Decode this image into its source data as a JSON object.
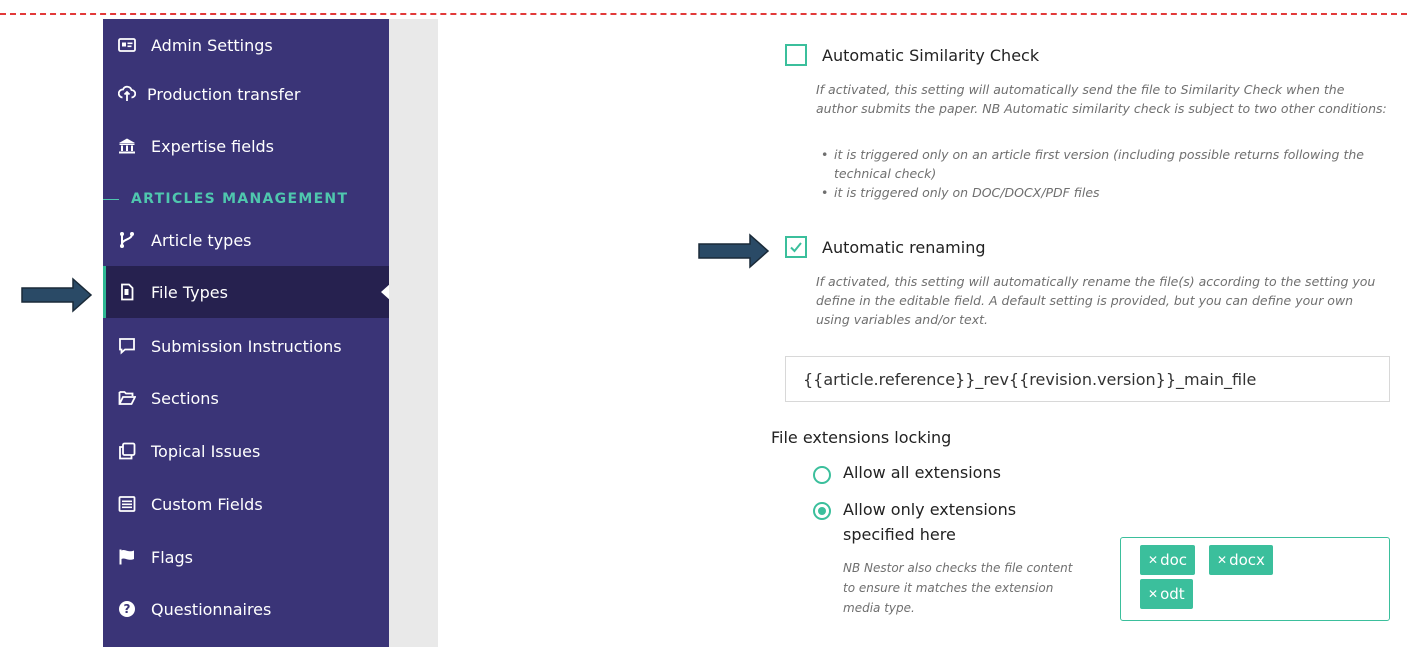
{
  "sidebar": {
    "items": [
      {
        "label": "Admin Settings",
        "icon": "id-card-icon"
      },
      {
        "label": "Production transfer",
        "icon": "cloud-transfer-icon"
      },
      {
        "label": "Expertise fields",
        "icon": "institution-icon"
      },
      {
        "label": "Article types",
        "icon": "branch-icon"
      },
      {
        "label": "File Types",
        "icon": "file-icon"
      },
      {
        "label": "Submission Instructions",
        "icon": "comment-icon"
      },
      {
        "label": "Sections",
        "icon": "folder-open-icon"
      },
      {
        "label": "Topical Issues",
        "icon": "copy-icon"
      },
      {
        "label": "Custom Fields",
        "icon": "list-icon"
      },
      {
        "label": "Flags",
        "icon": "flag-icon"
      },
      {
        "label": "Questionnaires",
        "icon": "question-circle-icon"
      }
    ],
    "section_label": "ARTICLES MANAGEMENT",
    "active": "File Types"
  },
  "similarity": {
    "title": "Automatic Similarity Check",
    "checked": false,
    "help": "If activated, this setting will automatically send the file to Similarity Check when the author submits the paper. NB Automatic similarity check is subject to two other conditions:",
    "bullets": [
      "it is triggered only on an article first version (including possible returns following the technical check)",
      "it is triggered only on DOC/DOCX/PDF files"
    ]
  },
  "renaming": {
    "title": "Automatic renaming",
    "checked": true,
    "help": "If activated, this setting will automatically rename the file(s) according to the setting you define in the editable field. A default setting is provided, but you can define your own using variables and/or text.",
    "pattern": "{{article.reference}}_rev{{revision.version}}_main_file"
  },
  "extensions": {
    "heading": "File extensions locking",
    "option_all": "Allow all extensions",
    "option_only": "Allow only extensions specified here",
    "selected": "only",
    "note": "NB Nestor also checks the file content to ensure it matches the extension media type.",
    "tags": [
      "doc",
      "docx",
      "odt"
    ]
  },
  "colors": {
    "sidebar_bg": "#3a3477",
    "sidebar_active_bg": "#26214f",
    "accent": "#3bbf9c",
    "arrow": "#2a4a66",
    "dashed_line": "#e23a3a"
  }
}
